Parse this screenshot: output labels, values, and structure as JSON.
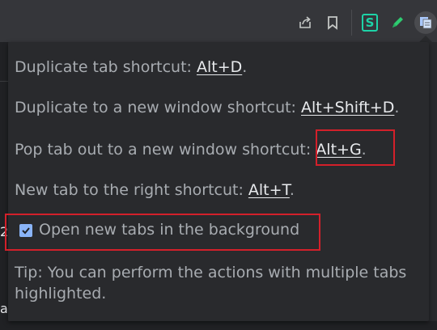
{
  "toolbar": {
    "icons": [
      "share-icon",
      "bookmark-icon",
      "extension-s-icon",
      "pen-icon",
      "duplicate-tab-icon"
    ],
    "extension_letter": "S"
  },
  "background": {
    "char_top": "2",
    "char_bottom": "a"
  },
  "popup": {
    "line1": {
      "text": "Duplicate tab shortcut: ",
      "shortcut": "Alt+D",
      "suffix": "."
    },
    "line2": {
      "text": "Duplicate to a new window shortcut: ",
      "shortcut": "Alt+Shift+D",
      "suffix": "."
    },
    "line3": {
      "text": "Pop tab out to a new window shortcut: ",
      "shortcut": "Alt+G",
      "suffix": "."
    },
    "line4": {
      "text": "New tab to the right shortcut: ",
      "shortcut": "Alt+T",
      "suffix": "."
    },
    "checkbox": {
      "label": "Open new tabs in the background",
      "checked": true
    },
    "tip": "Tip: You can perform the actions with multiple tabs highlighted."
  },
  "colors": {
    "highlight_box": "#d3202a",
    "checkbox": "#8ab4f8",
    "extension_green": "#1dd3a7"
  }
}
